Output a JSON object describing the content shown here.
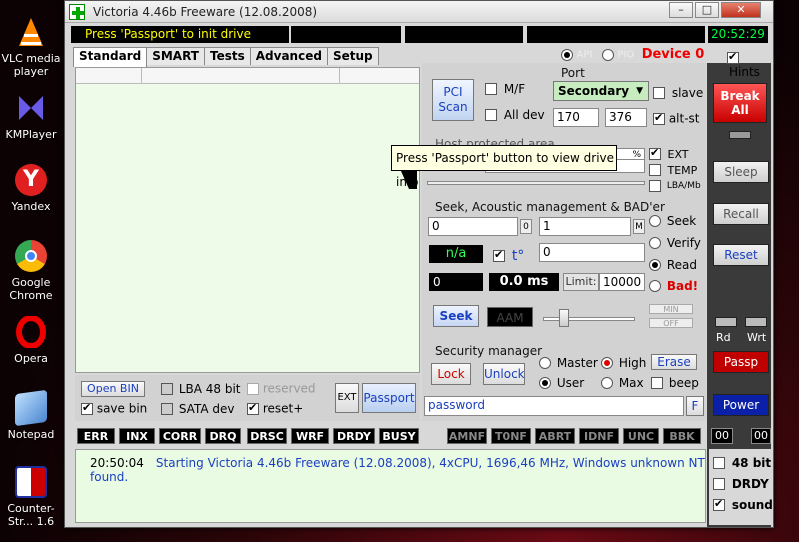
{
  "desktop": {
    "icons": [
      {
        "label": "VLC media player",
        "icon": "vlc-icon",
        "color": "#ff8800"
      },
      {
        "label": "KMPlayer",
        "icon": "kmplayer-icon",
        "color": "#4a40c8"
      },
      {
        "label": "Yandex",
        "icon": "yandex-icon",
        "color": "#e02020"
      },
      {
        "label": "Google Chrome",
        "icon": "chrome-icon",
        "color": "#34a853"
      },
      {
        "label": "Opera",
        "icon": "opera-icon",
        "color": "#d00000"
      },
      {
        "label": "Notepad",
        "icon": "notepad-icon",
        "color": "#6aa8e8"
      },
      {
        "label": "Counter-Str... 1.6",
        "icon": "cs-icon",
        "color": "#3040a0"
      }
    ]
  },
  "window": {
    "title": "Victoria 4.46b Freeware (12.08.2008)",
    "minimize": "–",
    "maximize": "□",
    "close": "✕",
    "status_message": "Press 'Passport' to init drive",
    "clock": "20:52:29"
  },
  "tabs": [
    "Standard",
    "SMART",
    "Tests",
    "Advanced",
    "Setup"
  ],
  "api_pio": {
    "api": "API",
    "pio": "PIO",
    "device": "Device 0"
  },
  "hints": "Hints",
  "pci": {
    "scan": "PCI\nScan",
    "mf": "M/F",
    "alldev": "All dev"
  },
  "port": {
    "title": "Port",
    "selected": "Secondary",
    "slave": "slave",
    "addr1": "170",
    "addr2": "376",
    "altst": "alt-st"
  },
  "hpa": {
    "title": "Host protected area",
    "pct": "%",
    "ext": "EXT",
    "temp": "TEMP",
    "lbamb": "LBA/Mb"
  },
  "tooltip": "Press 'Passport' button to view drive info",
  "seek": {
    "title": "Seek, Acoustic management & BAD'er",
    "start": "0",
    "start_suffix": "0",
    "end": "1",
    "end_suffix": "M",
    "na": "n/a",
    "temp": "t°",
    "temp_value": "0",
    "count": "0",
    "ms": "0.0 ms",
    "limit_label": "Limit:",
    "limit": "10000",
    "seek_btn": "Seek",
    "aam": "AAM",
    "min": "MIN",
    "off": "OFF",
    "modes": [
      "Seek",
      "Verify",
      "Read",
      "Bad!"
    ]
  },
  "security": {
    "title": "Security manager",
    "lock": "Lock",
    "unlock": "Unlock",
    "master": "Master",
    "high": "High",
    "erase": "Erase",
    "user": "User",
    "max": "Max",
    "beep": "beep",
    "password": "password",
    "f": "F"
  },
  "bottom_left": {
    "open_bin": "Open BIN",
    "save_bin": "save bin",
    "lba48": "LBA 48 bit",
    "sata": "SATA dev",
    "reserved": "reserved",
    "reset_plus": "reset+",
    "ext": "EXT",
    "passport": "Passport"
  },
  "codes": {
    "active": [
      "ERR",
      "INX",
      "CORR",
      "DRQ",
      "DRSC",
      "WRF",
      "DRDY",
      "BUSY"
    ],
    "inactive": [
      "AMNF",
      "T0NF",
      "ABRT",
      "IDNF",
      "UNC",
      "BBK"
    ]
  },
  "side": {
    "break_all": "Break All",
    "sleep": "Sleep",
    "recall": "Recall",
    "reset": "Reset",
    "rd": "Rd",
    "wrt": "Wrt",
    "passp": "Passp",
    "power": "Power",
    "hex1": "00",
    "hex2": "00",
    "bit48": "48 bit",
    "drdy": "DRDY",
    "sound": "sound"
  },
  "log": {
    "time": "20:50:04",
    "message": "Starting Victoria 4.46b Freeware (12.08.2008), 4xCPU, 1696,46 MHz, Windows unknown NT found."
  }
}
